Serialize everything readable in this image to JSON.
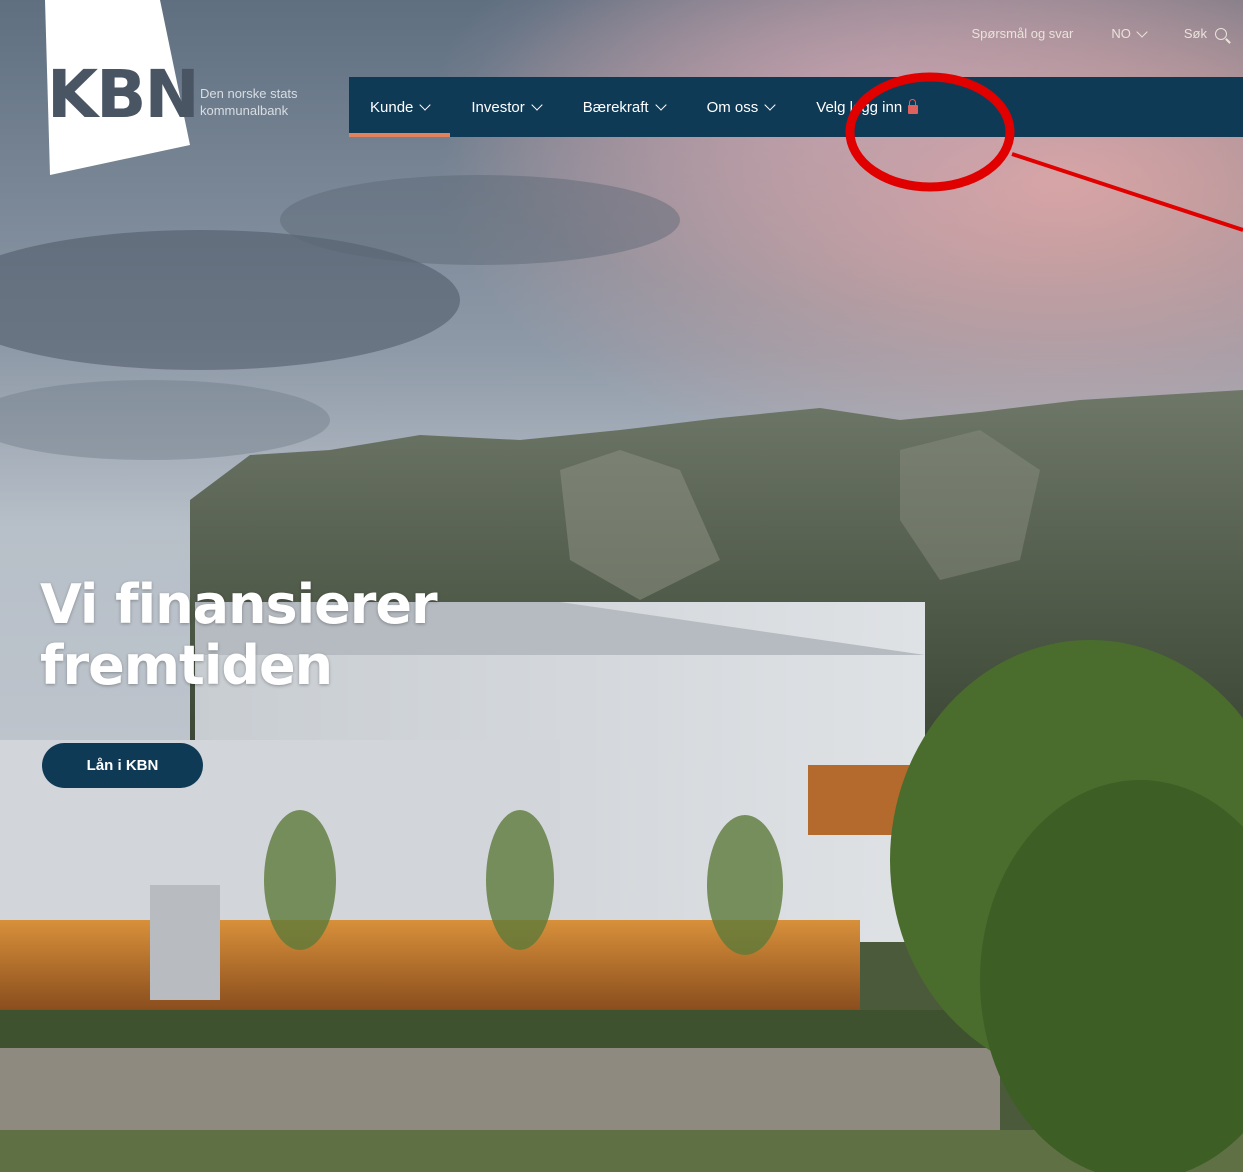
{
  "brand": {
    "logo_text": "KBN",
    "tagline_line1": "Den norske stats",
    "tagline_line2": "kommunalbank"
  },
  "utility_nav": {
    "faq": "Spørsmål og svar",
    "language": "NO",
    "search": "Søk"
  },
  "main_nav": {
    "items": [
      {
        "label": "Kunde"
      },
      {
        "label": "Investor"
      },
      {
        "label": "Bærekraft"
      },
      {
        "label": "Om oss"
      }
    ],
    "login": "Velg logg inn"
  },
  "hero": {
    "headline_line1": "Vi finansierer",
    "headline_line2": "fremtiden",
    "cta": "Lån i KBN"
  },
  "colors": {
    "navy": "#0f3a56",
    "accent": "#e0835d",
    "annotation_red": "#e00000"
  }
}
